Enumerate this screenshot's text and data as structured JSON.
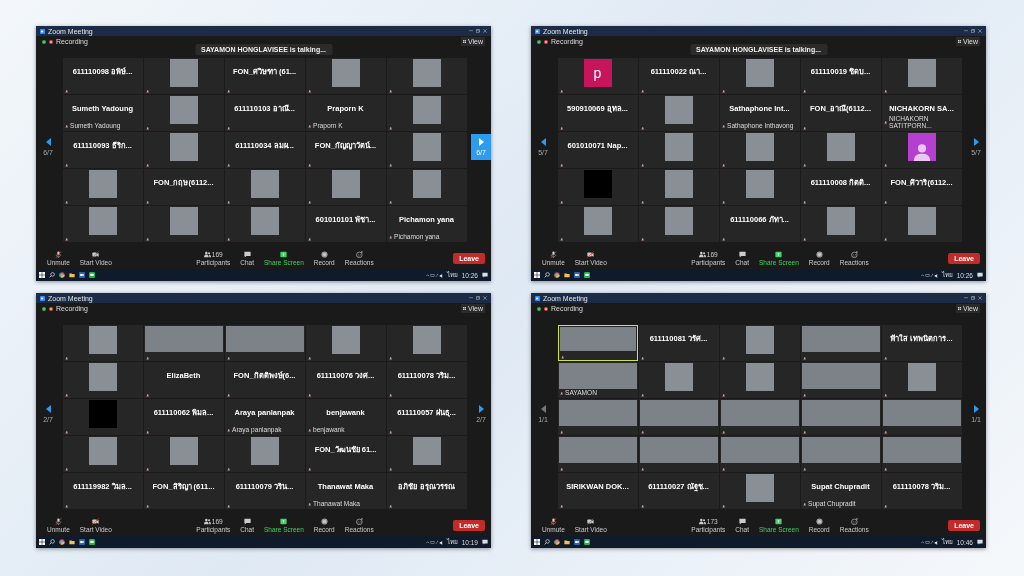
{
  "windows": [
    {
      "title": "Zoom Meeting",
      "recording": "Recording",
      "view": "View",
      "banner": "SAYAMON HONGLAVISEE is talking...",
      "nav": {
        "page_left": "6/7",
        "page_right": "6/7",
        "prev_disabled": false,
        "next_hovered": true
      },
      "tiles": [
        {
          "kind": "name",
          "name": "611110098 อพิษ์...",
          "speaking": false
        },
        {
          "kind": "video",
          "speaking": false
        },
        {
          "kind": "name",
          "name": "FON_ศวิษฑา (61...",
          "speaking": false
        },
        {
          "kind": "video",
          "speaking": false
        },
        {
          "kind": "video",
          "speaking": false
        },
        {
          "kind": "name",
          "name": "Sumeth Yadoung",
          "label": "Sumeth Yadoung",
          "speaking": false
        },
        {
          "kind": "video",
          "speaking": false
        },
        {
          "kind": "name",
          "name": "611110103 อาณี...",
          "speaking": false
        },
        {
          "kind": "name",
          "name": "Praporn K",
          "label": "Praporn K",
          "speaking": false
        },
        {
          "kind": "video",
          "speaking": false
        },
        {
          "kind": "name",
          "name": "611110093 ธีริก...",
          "speaking": false
        },
        {
          "kind": "video",
          "speaking": false
        },
        {
          "kind": "name",
          "name": "611110034 ลมผ...",
          "speaking": false
        },
        {
          "kind": "name",
          "name": "FON_กัญญาวัตน์...",
          "speaking": false
        },
        {
          "kind": "video",
          "speaking": false
        },
        {
          "kind": "video",
          "speaking": false
        },
        {
          "kind": "name",
          "name": "FON_กฤษ(6112...",
          "speaking": false
        },
        {
          "kind": "video",
          "speaking": false
        },
        {
          "kind": "video",
          "speaking": false
        },
        {
          "kind": "video",
          "speaking": false
        },
        {
          "kind": "video",
          "speaking": false
        },
        {
          "kind": "video",
          "speaking": false
        },
        {
          "kind": "video",
          "speaking": false
        },
        {
          "kind": "name",
          "name": "601010101 พัชา...",
          "speaking": false
        },
        {
          "kind": "name",
          "name": "Pichamon yana",
          "label": "Pichamon yana",
          "speaking": false
        }
      ],
      "toolbar": {
        "unmute": "Unmute",
        "video": "Start Video",
        "participants": "Participants",
        "count": "169",
        "chat": "Chat",
        "share": "Share Screen",
        "record": "Record",
        "reactions": "Reactions",
        "leave": "Leave"
      },
      "taskbar": {
        "language": "ไทย",
        "time": "10:26"
      }
    },
    {
      "title": "Zoom Meeting",
      "recording": "Recording",
      "view": "View",
      "banner": "SAYAMON HONGLAVISEE is talking...",
      "nav": {
        "page_left": "5/7",
        "page_right": "5/7",
        "prev_disabled": false,
        "next_hovered": false
      },
      "tiles": [
        {
          "kind": "letter",
          "letter": "p",
          "speaking": false
        },
        {
          "kind": "name",
          "name": "611110022 ณา...",
          "speaking": false
        },
        {
          "kind": "video",
          "speaking": false
        },
        {
          "kind": "name",
          "name": "611110019 ชิดบ...",
          "speaking": false
        },
        {
          "kind": "video",
          "speaking": false
        },
        {
          "kind": "name",
          "name": "590910069 อุทล...",
          "speaking": false
        },
        {
          "kind": "video",
          "speaking": false
        },
        {
          "kind": "name",
          "name": "Sathaphone  Int...",
          "label": "Sathaphone Inthavong",
          "speaking": false
        },
        {
          "kind": "name",
          "name": "FON_อาณี(6112...",
          "speaking": false
        },
        {
          "kind": "name",
          "name": "NICHAKORN  SA...",
          "label": "NICHAKORN SATITPORN...",
          "speaking": false
        },
        {
          "kind": "name",
          "name": "601010071  Nap...",
          "speaking": false
        },
        {
          "kind": "video",
          "speaking": false
        },
        {
          "kind": "video",
          "speaking": false
        },
        {
          "kind": "video",
          "speaking": false
        },
        {
          "kind": "person",
          "speaking": false
        },
        {
          "kind": "blank",
          "speaking": false
        },
        {
          "kind": "video",
          "speaking": false
        },
        {
          "kind": "video",
          "speaking": false
        },
        {
          "kind": "name",
          "name": "611110008 กิตติ...",
          "speaking": false
        },
        {
          "kind": "name",
          "name": "FON_ศิวาริ(6112...",
          "speaking": false
        },
        {
          "kind": "video",
          "speaking": false
        },
        {
          "kind": "video",
          "speaking": false
        },
        {
          "kind": "name",
          "name": "611110066 ภัทา...",
          "speaking": false
        },
        {
          "kind": "video",
          "speaking": false
        },
        {
          "kind": "video",
          "speaking": false
        }
      ],
      "toolbar": {
        "unmute": "Unmute",
        "video": "Start Video",
        "participants": "Participants",
        "count": "169",
        "chat": "Chat",
        "share": "Share Screen",
        "record": "Record",
        "reactions": "Reactions",
        "leave": "Leave"
      },
      "taskbar": {
        "language": "ไทย",
        "time": "10:26"
      }
    },
    {
      "title": "Zoom Meeting",
      "recording": "Recording",
      "view": "View",
      "nav": {
        "page_left": "2/7",
        "page_right": "2/7",
        "prev_disabled": false,
        "next_hovered": false
      },
      "tiles": [
        {
          "kind": "video",
          "speaking": false
        },
        {
          "kind": "wide_video",
          "speaking": false
        },
        {
          "kind": "wide_video",
          "speaking": false
        },
        {
          "kind": "video",
          "speaking": false
        },
        {
          "kind": "video",
          "speaking": false
        },
        {
          "kind": "video",
          "speaking": false
        },
        {
          "kind": "name",
          "name": "ElizaBeth",
          "speaking": false
        },
        {
          "kind": "name",
          "name": "FON_กิตติพงษ์(6...",
          "speaking": false
        },
        {
          "kind": "name",
          "name": "611110076 วงศ...",
          "speaking": false
        },
        {
          "kind": "name",
          "name": "611110078 วริม...",
          "speaking": false
        },
        {
          "kind": "blank",
          "speaking": false
        },
        {
          "kind": "name",
          "name": "611110062 พิมล...",
          "speaking": false
        },
        {
          "kind": "name",
          "name": "Araya panlanpak",
          "label": "Araya panlanpak",
          "speaking": false
        },
        {
          "kind": "name",
          "name": "benjawank",
          "label": "benjawank",
          "speaking": false
        },
        {
          "kind": "name",
          "name": "611110057 ฝนธุ...",
          "speaking": false
        },
        {
          "kind": "video",
          "speaking": false
        },
        {
          "kind": "video",
          "speaking": false
        },
        {
          "kind": "video",
          "speaking": false
        },
        {
          "kind": "name",
          "name": "FON_วัฒนชัย 61...",
          "speaking": false
        },
        {
          "kind": "video",
          "speaking": false
        },
        {
          "kind": "name",
          "name": "611119982 วิมล...",
          "speaking": false
        },
        {
          "kind": "name",
          "name": "FON_สิริญา (611...",
          "speaking": false
        },
        {
          "kind": "name",
          "name": "611110079 วริน...",
          "speaking": false
        },
        {
          "kind": "name",
          "name": "Thanawat Maka",
          "label": "Thanawat Maka",
          "speaking": false
        },
        {
          "kind": "name",
          "name": "อภิชัย อรุณวรรณ",
          "speaking": false
        }
      ],
      "toolbar": {
        "unmute": "Unmute",
        "video": "Start Video",
        "participants": "Participants",
        "count": "169",
        "chat": "Chat",
        "share": "Share Screen",
        "record": "Record",
        "reactions": "Reactions",
        "leave": "Leave"
      },
      "taskbar": {
        "language": "ไทย",
        "time": "10:19"
      }
    },
    {
      "title": "Zoom Meeting",
      "recording": "Recording",
      "view": "View",
      "nav": {
        "page_left": "1/1",
        "page_right": "1/1",
        "prev_disabled": true,
        "next_hovered": false
      },
      "tiles": [
        {
          "kind": "wide_video",
          "speaking": true
        },
        {
          "kind": "name",
          "name": "611110081 วรัศ...",
          "speaking": false
        },
        {
          "kind": "video",
          "speaking": false
        },
        {
          "kind": "wide_video",
          "speaking": false
        },
        {
          "kind": "name",
          "name": "ฟ้าใส เทพนิตการ...",
          "speaking": false
        },
        {
          "kind": "wide_video",
          "label": "SAYAMON",
          "speaking": false
        },
        {
          "kind": "video",
          "speaking": false
        },
        {
          "kind": "video",
          "speaking": false
        },
        {
          "kind": "wide_video",
          "speaking": false
        },
        {
          "kind": "video",
          "speaking": false
        },
        {
          "kind": "wide_video",
          "speaking": false
        },
        {
          "kind": "wide_video",
          "speaking": false
        },
        {
          "kind": "wide_video",
          "speaking": false
        },
        {
          "kind": "wide_video",
          "speaking": false
        },
        {
          "kind": "wide_video",
          "speaking": false
        },
        {
          "kind": "wide_video",
          "speaking": false
        },
        {
          "kind": "wide_video",
          "speaking": false
        },
        {
          "kind": "wide_video",
          "speaking": false
        },
        {
          "kind": "wide_video",
          "speaking": false
        },
        {
          "kind": "wide_video",
          "speaking": false
        },
        {
          "kind": "name",
          "name": "SIRIKWAN  DOK...",
          "speaking": false
        },
        {
          "kind": "name",
          "name": "611110027 ณัฐช...",
          "speaking": false
        },
        {
          "kind": "video",
          "speaking": false
        },
        {
          "kind": "name",
          "name": "Supat Chupradit",
          "label": "Supat Chupradit",
          "speaking": false
        },
        {
          "kind": "name",
          "name": "611110078 วริม...",
          "speaking": false
        }
      ],
      "toolbar": {
        "unmute": "Unmute",
        "video": "Start Video",
        "participants": "Participants",
        "count": "173",
        "chat": "Chat",
        "share": "Share Screen",
        "record": "Record",
        "reactions": "Reactions",
        "leave": "Leave"
      },
      "taskbar": {
        "language": "ไทย",
        "time": "10:46"
      }
    }
  ]
}
